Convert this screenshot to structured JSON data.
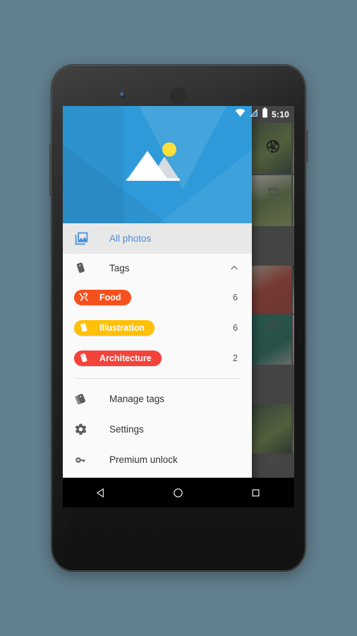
{
  "device": {
    "name": "android-phone-nexus5",
    "earpiece": "earpiece-speaker",
    "front_camera": "front-camera",
    "volume_button": "volume-rocker",
    "power_button": "power-button"
  },
  "statusbar": {
    "time": "5:10",
    "wifi_icon": "wifi-icon",
    "signal_icon": "cell-signal-icon",
    "battery_icon": "battery-icon"
  },
  "background": {
    "camera_icon": "camera-aperture-icon",
    "folder_icon": "folder-icon",
    "thumbnails": [
      {
        "name": "photo-leaves-1",
        "colors": [
          "#3d5a3a",
          "#6f8b3e",
          "#233a2a"
        ]
      },
      {
        "name": "photo-leaves-2",
        "colors": [
          "#4d6b32",
          "#86a046",
          "#2c4226"
        ]
      },
      {
        "name": "photo-flower",
        "colors": [
          "#e8e6de",
          "#5f7c3c",
          "#8fa659"
        ]
      },
      {
        "name": "photo-hat",
        "colors": [
          "#cbbca0",
          "#8d7a58",
          "#e3d8c2"
        ]
      },
      {
        "name": "photo-red-wall",
        "colors": [
          "#c0392b",
          "#a33026",
          "#cbbda6"
        ]
      },
      {
        "name": "photo-dark-beige",
        "colors": [
          "#1d1c18",
          "#cfc49f",
          "#8d8468"
        ]
      },
      {
        "name": "photo-teal",
        "colors": [
          "#0f7562",
          "#10695a",
          "#9aa89f"
        ]
      },
      {
        "name": "photo-skin",
        "colors": [
          "#d7c9bd",
          "#c79d86",
          "#b9b0a8"
        ]
      }
    ]
  },
  "drawer": {
    "header": {
      "logo_name": "gallery-landscape-logo",
      "sun_color": "#ffe03a",
      "mountain_color": "#ffffff",
      "mountain_shadow_color": "#d6dce0",
      "background_color": "#2f9ada"
    },
    "all_photos": {
      "label": "All photos",
      "icon": "photo-library-icon",
      "selected": true,
      "accent_color": "#4a90d9"
    },
    "tags_section": {
      "label": "Tags",
      "icon": "tag-icon",
      "chevron_icon": "chevron-up-icon",
      "expanded": true,
      "tags": [
        {
          "label": "Food",
          "count": "6",
          "color": "#f4511e",
          "icon": "cutlery-icon"
        },
        {
          "label": "Illustration",
          "count": "6",
          "color": "#ffc107",
          "icon": "tag-icon"
        },
        {
          "label": "Architecture",
          "count": "2",
          "color": "#f4433a",
          "icon": "tag-icon"
        }
      ]
    },
    "menu_items": [
      {
        "label": "Manage tags",
        "icon": "tags-stack-icon"
      },
      {
        "label": "Settings",
        "icon": "gear-icon"
      },
      {
        "label": "Premium unlock",
        "icon": "key-icon"
      }
    ]
  },
  "navbar": {
    "back": "back-triangle-icon",
    "home": "home-circle-icon",
    "recents": "recents-square-icon"
  }
}
